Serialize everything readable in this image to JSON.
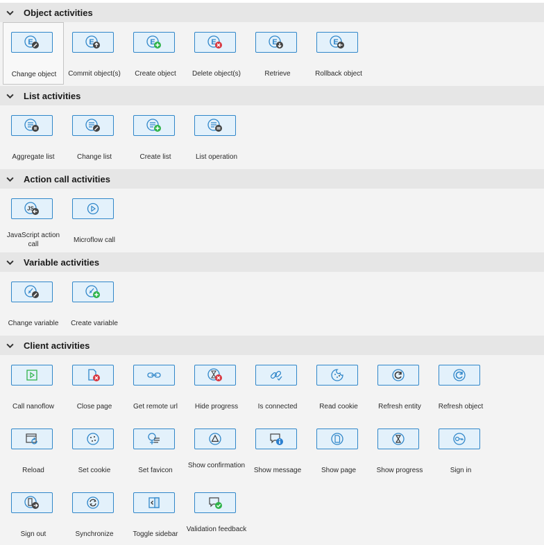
{
  "sections": [
    {
      "title": "Object activities",
      "items": [
        {
          "label": "Change object",
          "icon": "change-object-icon"
        },
        {
          "label": "Commit object(s)",
          "icon": "commit-object-icon"
        },
        {
          "label": "Create object",
          "icon": "create-object-icon"
        },
        {
          "label": "Delete object(s)",
          "icon": "delete-object-icon"
        },
        {
          "label": "Retrieve",
          "icon": "retrieve-icon"
        },
        {
          "label": "Rollback object",
          "icon": "rollback-object-icon"
        }
      ]
    },
    {
      "title": "List activities",
      "items": [
        {
          "label": "Aggregate list",
          "icon": "aggregate-list-icon"
        },
        {
          "label": "Change list",
          "icon": "change-list-icon"
        },
        {
          "label": "Create list",
          "icon": "create-list-icon"
        },
        {
          "label": "List operation",
          "icon": "list-operation-icon"
        }
      ]
    },
    {
      "title": "Action call activities",
      "items": [
        {
          "label": "JavaScript action call",
          "icon": "javascript-action-call-icon"
        },
        {
          "label": "Microflow call",
          "icon": "microflow-call-icon"
        }
      ]
    },
    {
      "title": "Variable activities",
      "items": [
        {
          "label": "Change variable",
          "icon": "change-variable-icon"
        },
        {
          "label": "Create variable",
          "icon": "create-variable-icon"
        }
      ]
    },
    {
      "title": "Client activities",
      "items": [
        {
          "label": "Call nanoflow",
          "icon": "call-nanoflow-icon"
        },
        {
          "label": "Close page",
          "icon": "close-page-icon"
        },
        {
          "label": "Get remote url",
          "icon": "get-remote-url-icon"
        },
        {
          "label": "Hide progress",
          "icon": "hide-progress-icon"
        },
        {
          "label": "Is connected",
          "icon": "is-connected-icon"
        },
        {
          "label": "Read cookie",
          "icon": "read-cookie-icon"
        },
        {
          "label": "Refresh entity",
          "icon": "refresh-entity-icon"
        },
        {
          "label": "Refresh object",
          "icon": "refresh-object-icon"
        },
        {
          "label": "Reload",
          "icon": "reload-icon"
        },
        {
          "label": "Set cookie",
          "icon": "set-cookie-icon"
        },
        {
          "label": "Set favicon",
          "icon": "set-favicon-icon"
        },
        {
          "label": "Show confirmation",
          "icon": "show-confirmation-icon"
        },
        {
          "label": "Show message",
          "icon": "show-message-icon"
        },
        {
          "label": "Show page",
          "icon": "show-page-icon"
        },
        {
          "label": "Show progress",
          "icon": "show-progress-icon"
        },
        {
          "label": "Sign in",
          "icon": "sign-in-icon"
        },
        {
          "label": "Sign out",
          "icon": "sign-out-icon"
        },
        {
          "label": "Synchronize",
          "icon": "synchronize-icon"
        },
        {
          "label": "Toggle sidebar",
          "icon": "toggle-sidebar-icon"
        },
        {
          "label": "Validation feedback",
          "icon": "validation-feedback-icon"
        }
      ]
    }
  ],
  "selected": "Change object",
  "colors": {
    "icon_border": "#2f86c9",
    "icon_fill": "#e3f1fb",
    "badge_dark": "#444444",
    "badge_green": "#2fb34a",
    "badge_red": "#d8363f",
    "badge_blue": "#2a7fd0"
  }
}
